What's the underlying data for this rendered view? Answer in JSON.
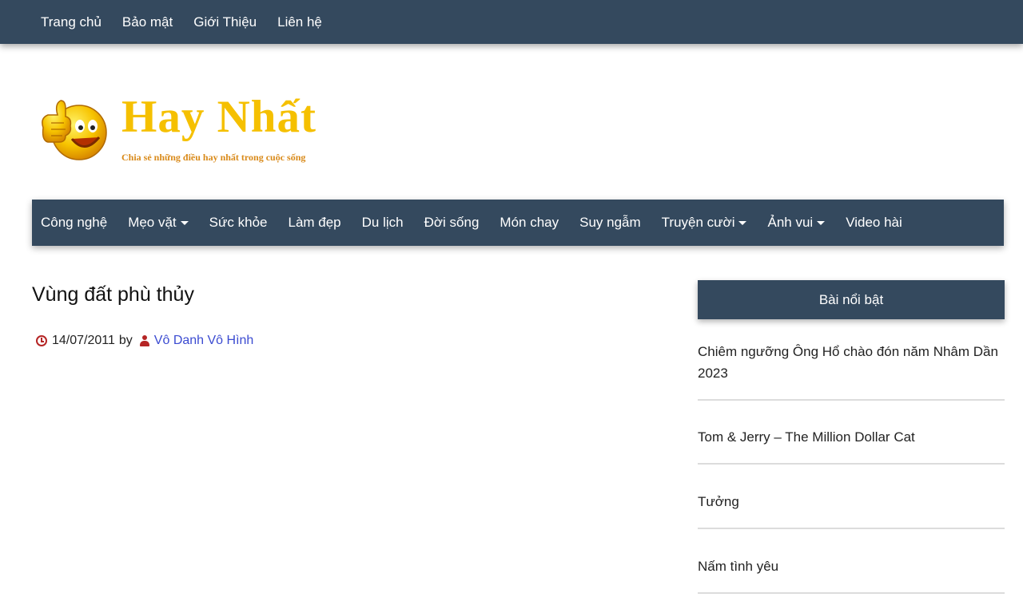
{
  "topnav": {
    "items": [
      {
        "label": "Trang chủ"
      },
      {
        "label": "Bảo mật"
      },
      {
        "label": "Giới Thiệu"
      },
      {
        "label": "Liên hệ"
      }
    ]
  },
  "logo": {
    "title": "Hay Nhất",
    "tagline": "Chia sẻ những điều hay nhất trong cuộc sống"
  },
  "mainnav": {
    "items": [
      {
        "label": "Công nghệ",
        "dropdown": false
      },
      {
        "label": "Mẹo vặt",
        "dropdown": true
      },
      {
        "label": "Sức khỏe",
        "dropdown": false
      },
      {
        "label": "Làm đẹp",
        "dropdown": false
      },
      {
        "label": "Du lịch",
        "dropdown": false
      },
      {
        "label": "Đời sống",
        "dropdown": false
      },
      {
        "label": "Món chay",
        "dropdown": false
      },
      {
        "label": "Suy ngẫm",
        "dropdown": false
      },
      {
        "label": "Truyện cười",
        "dropdown": true
      },
      {
        "label": "Ảnh vui",
        "dropdown": true
      },
      {
        "label": "Video hài",
        "dropdown": false
      }
    ]
  },
  "post": {
    "title": "Vùng đất phù thủy",
    "date": "14/07/2011",
    "by": "by",
    "author": "Vô Danh Vô Hình"
  },
  "sidebar": {
    "title": "Bài nổi bật",
    "items": [
      {
        "label": "Chiêm ngưỡng Ông Hổ chào đón năm Nhâm Dần 2023"
      },
      {
        "label": "Tom & Jerry – The Million Dollar Cat"
      },
      {
        "label": "Tưởng"
      },
      {
        "label": "Nấm tình yêu"
      }
    ]
  },
  "colors": {
    "nav_bg": "#34495e",
    "logo_gold": "#f5c000",
    "icon_red": "#b52525",
    "link_blue": "#3b4bd1"
  }
}
